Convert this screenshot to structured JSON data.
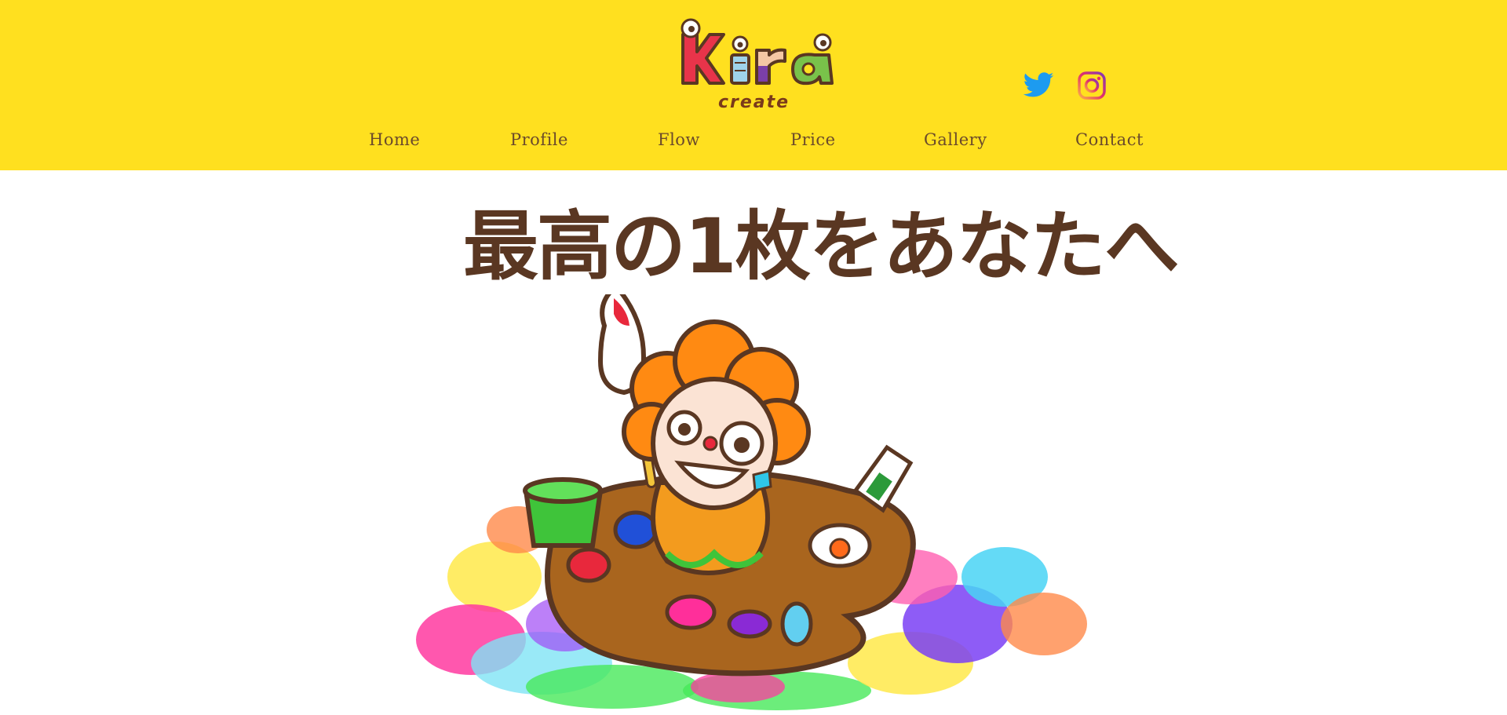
{
  "header": {
    "logo_text": "Kira",
    "logo_subtext": "create",
    "social": [
      {
        "name": "twitter",
        "icon": "twitter-bird-icon",
        "color": "#1d9bf0"
      },
      {
        "name": "instagram",
        "icon": "instagram-icon",
        "color": "#e1306c"
      }
    ],
    "background": "#ffe01f"
  },
  "nav": {
    "items": [
      {
        "label": "Home"
      },
      {
        "label": "Profile"
      },
      {
        "label": "Flow"
      },
      {
        "label": "Price"
      },
      {
        "label": "Gallery"
      },
      {
        "label": "Contact"
      }
    ]
  },
  "hero": {
    "title": "最高の1枚をあなたへ",
    "illustration": "painter-character-illustration"
  }
}
